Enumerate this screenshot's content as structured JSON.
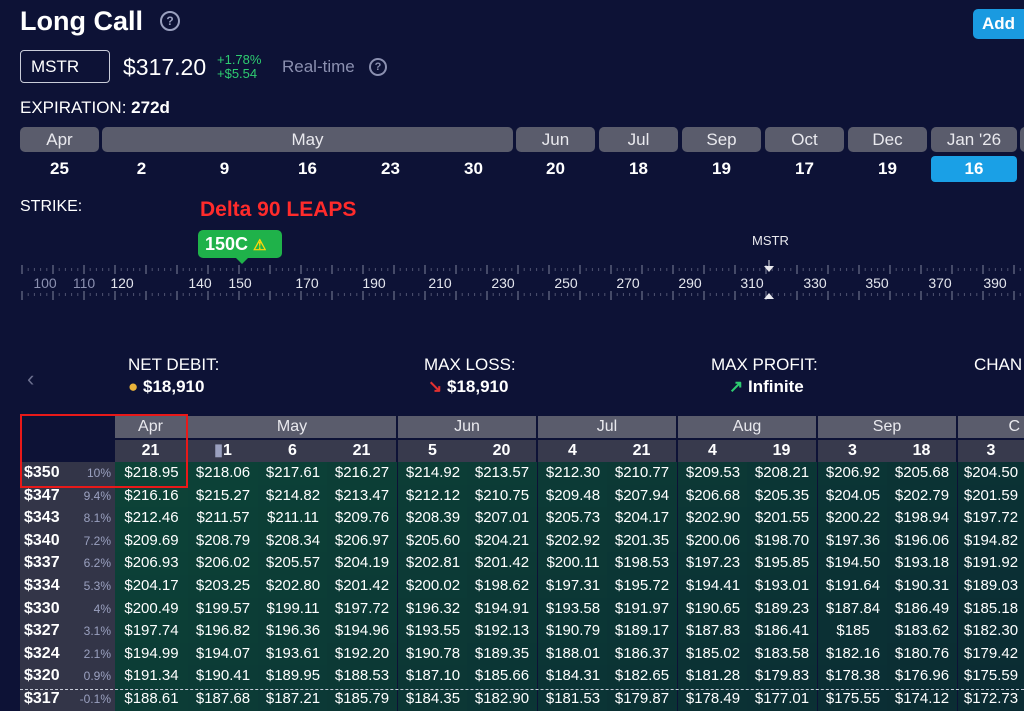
{
  "header": {
    "title": "Long Call",
    "help_icon": "question-circle-icon",
    "add_label": "Add"
  },
  "quote": {
    "ticker": "MSTR",
    "price": "$317.20",
    "change_pct": "+1.78%",
    "change_abs": "+$5.54",
    "realtime_label": "Real-time"
  },
  "expiration": {
    "label": "EXPIRATION:",
    "value": "272d",
    "months": [
      "Apr",
      "May",
      "Jun",
      "Jul",
      "Sep",
      "Oct",
      "Dec",
      "Jan '26"
    ],
    "days": [
      "25",
      "2",
      "9",
      "16",
      "23",
      "30",
      "20",
      "18",
      "19",
      "17",
      "19",
      "16"
    ],
    "selected_day": "16"
  },
  "strike": {
    "label": "STRIKE:",
    "annotation": "Delta 90 LEAPS",
    "badge": "150C",
    "badge_icon": "warning-icon",
    "marker_label": "MSTR",
    "ticks": [
      "100",
      "110",
      "120",
      "140",
      "150",
      "170",
      "190",
      "210",
      "230",
      "250",
      "270",
      "290",
      "310",
      "330",
      "350",
      "370",
      "390"
    ]
  },
  "summary": {
    "net_debit_label": "NET DEBIT:",
    "net_debit_value": "$18,910",
    "max_loss_label": "MAX LOSS:",
    "max_loss_value": "$18,910",
    "max_profit_label": "MAX PROFIT:",
    "max_profit_value": "Infinite",
    "chance_label": "CHAN"
  },
  "grid": {
    "months": [
      "Apr",
      "May",
      "Jun",
      "Jul",
      "Aug",
      "Sep",
      "C"
    ],
    "days": [
      "21",
      "1",
      "6",
      "21",
      "5",
      "20",
      "4",
      "21",
      "4",
      "19",
      "3",
      "18",
      "3"
    ],
    "rows": [
      {
        "price": "$350",
        "pct": "10%",
        "values": [
          "$218.95",
          "$218.06",
          "$217.61",
          "$216.27",
          "$214.92",
          "$213.57",
          "$212.30",
          "$210.77",
          "$209.53",
          "$208.21",
          "$206.92",
          "$205.68",
          "$204.50"
        ]
      },
      {
        "price": "$347",
        "pct": "9.4%",
        "values": [
          "$216.16",
          "$215.27",
          "$214.82",
          "$213.47",
          "$212.12",
          "$210.75",
          "$209.48",
          "$207.94",
          "$206.68",
          "$205.35",
          "$204.05",
          "$202.79",
          "$201.59"
        ]
      },
      {
        "price": "$343",
        "pct": "8.1%",
        "values": [
          "$212.46",
          "$211.57",
          "$211.11",
          "$209.76",
          "$208.39",
          "$207.01",
          "$205.73",
          "$204.17",
          "$202.90",
          "$201.55",
          "$200.22",
          "$198.94",
          "$197.72"
        ]
      },
      {
        "price": "$340",
        "pct": "7.2%",
        "values": [
          "$209.69",
          "$208.79",
          "$208.34",
          "$206.97",
          "$205.60",
          "$204.21",
          "$202.92",
          "$201.35",
          "$200.06",
          "$198.70",
          "$197.36",
          "$196.06",
          "$194.82"
        ]
      },
      {
        "price": "$337",
        "pct": "6.2%",
        "values": [
          "$206.93",
          "$206.02",
          "$205.57",
          "$204.19",
          "$202.81",
          "$201.42",
          "$200.11",
          "$198.53",
          "$197.23",
          "$195.85",
          "$194.50",
          "$193.18",
          "$191.92"
        ]
      },
      {
        "price": "$334",
        "pct": "5.3%",
        "values": [
          "$204.17",
          "$203.25",
          "$202.80",
          "$201.42",
          "$200.02",
          "$198.62",
          "$197.31",
          "$195.72",
          "$194.41",
          "$193.01",
          "$191.64",
          "$190.31",
          "$189.03"
        ]
      },
      {
        "price": "$330",
        "pct": "4%",
        "values": [
          "$200.49",
          "$199.57",
          "$199.11",
          "$197.72",
          "$196.32",
          "$194.91",
          "$193.58",
          "$191.97",
          "$190.65",
          "$189.23",
          "$187.84",
          "$186.49",
          "$185.18"
        ]
      },
      {
        "price": "$327",
        "pct": "3.1%",
        "values": [
          "$197.74",
          "$196.82",
          "$196.36",
          "$194.96",
          "$193.55",
          "$192.13",
          "$190.79",
          "$189.17",
          "$187.83",
          "$186.41",
          "$185",
          "$183.62",
          "$182.30"
        ]
      },
      {
        "price": "$324",
        "pct": "2.1%",
        "values": [
          "$194.99",
          "$194.07",
          "$193.61",
          "$192.20",
          "$190.78",
          "$189.35",
          "$188.01",
          "$186.37",
          "$185.02",
          "$183.58",
          "$182.16",
          "$180.76",
          "$179.42"
        ]
      },
      {
        "price": "$320",
        "pct": "0.9%",
        "values": [
          "$191.34",
          "$190.41",
          "$189.95",
          "$188.53",
          "$187.10",
          "$185.66",
          "$184.31",
          "$182.65",
          "$181.28",
          "$179.83",
          "$178.38",
          "$176.96",
          "$175.59"
        ]
      },
      {
        "price": "$317",
        "pct": "-0.1%",
        "values": [
          "$188.61",
          "$187.68",
          "$187.21",
          "$185.79",
          "$184.35",
          "$182.90",
          "$181.53",
          "$179.87",
          "$178.49",
          "$177.01",
          "$175.55",
          "$174.12",
          "$172.73"
        ]
      }
    ]
  },
  "colors": {
    "background": "#0d1236",
    "accent": "#1a9ae0",
    "positive": "#2ecc71",
    "negative": "#e03030",
    "badge": "#1fb24a",
    "annotation": "#ff2b2b"
  }
}
